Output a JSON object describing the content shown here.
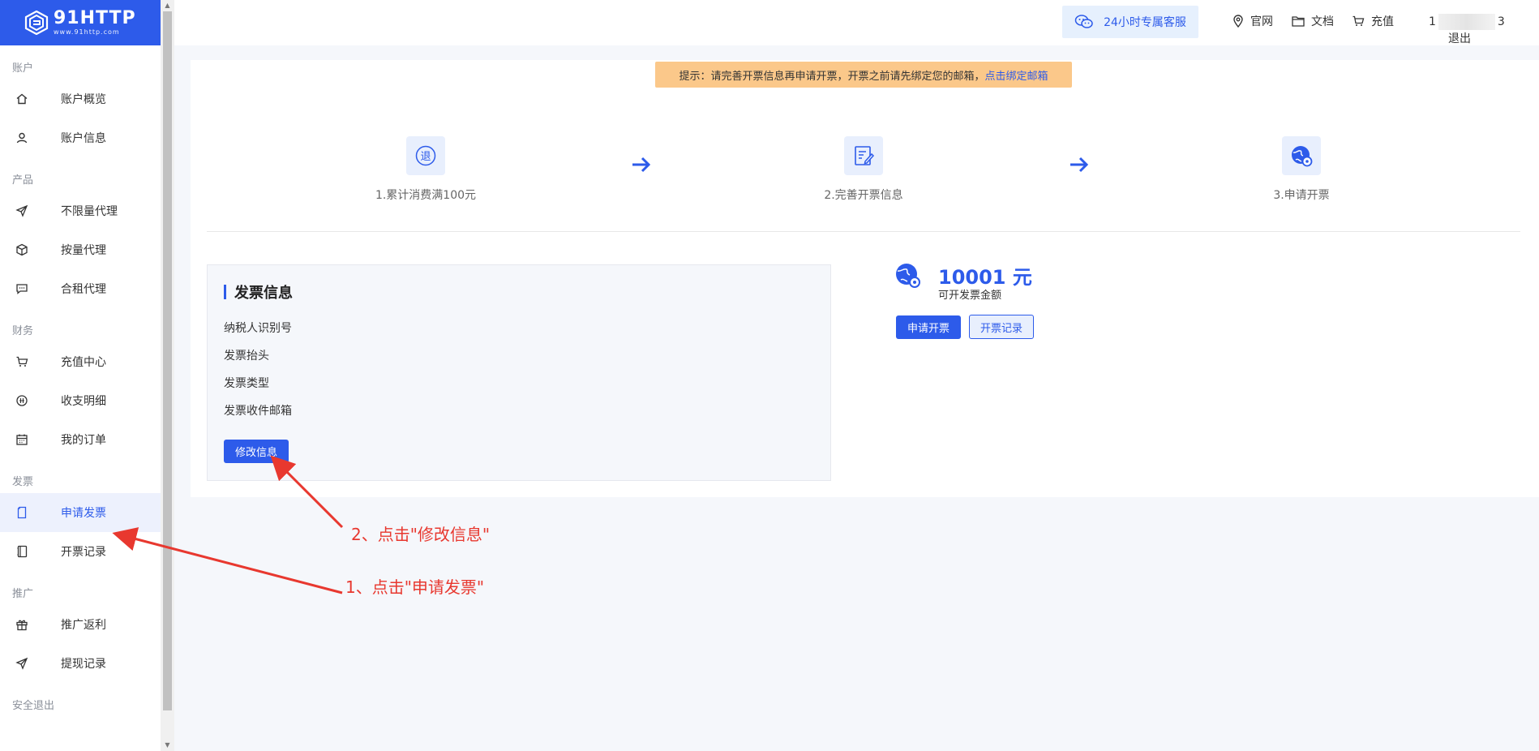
{
  "logo": {
    "name": "91HTTP",
    "url": "www.91http.com"
  },
  "sidebar": {
    "sections": [
      {
        "title": "账户",
        "items": [
          {
            "label": "账户概览",
            "icon": "home-icon"
          },
          {
            "label": "账户信息",
            "icon": "user-icon"
          }
        ]
      },
      {
        "title": "产品",
        "items": [
          {
            "label": "不限量代理",
            "icon": "send-icon"
          },
          {
            "label": "按量代理",
            "icon": "box-icon"
          },
          {
            "label": "合租代理",
            "icon": "chat-icon"
          }
        ]
      },
      {
        "title": "财务",
        "items": [
          {
            "label": "充值中心",
            "icon": "cart-icon"
          },
          {
            "label": "收支明细",
            "icon": "coin-icon"
          },
          {
            "label": "我的订单",
            "icon": "calendar-icon"
          }
        ]
      },
      {
        "title": "发票",
        "items": [
          {
            "label": "申请发票",
            "icon": "document-icon",
            "active": true
          },
          {
            "label": "开票记录",
            "icon": "notebook-icon"
          }
        ]
      },
      {
        "title": "推广",
        "items": [
          {
            "label": "推广返利",
            "icon": "gift-icon"
          },
          {
            "label": "提现记录",
            "icon": "send-icon"
          }
        ]
      },
      {
        "title": "安全退出",
        "items": []
      }
    ]
  },
  "topbar": {
    "support": "24小时专属客服",
    "official": "官网",
    "docs": "文档",
    "recharge": "充值",
    "user_prefix": "1",
    "user_suffix": "3",
    "logout": "退出"
  },
  "notice": {
    "text": "提示：请完善开票信息再申请开票，开票之前请先绑定您的邮箱，",
    "link": "点击绑定邮箱"
  },
  "steps": [
    {
      "label": "1.累计消费满100元",
      "icon_text": "退"
    },
    {
      "label": "2.完善开票信息"
    },
    {
      "label": "3.申请开票"
    }
  ],
  "invoice": {
    "title": "发票信息",
    "fields": [
      "纳税人识别号",
      "发票抬头",
      "发票类型",
      "发票收件邮箱"
    ],
    "edit_button": "修改信息"
  },
  "amount": {
    "value": "10001 元",
    "label": "可开发票金额",
    "apply_button": "申请开票",
    "records_button": "开票记录"
  },
  "annotations": {
    "step1": "1、点击\"申请发票\"",
    "step2": "2、点击\"修改信息\""
  },
  "colors": {
    "brand": "#2d5bea",
    "notice_bg": "#fbc88a",
    "annotation": "#e8382f"
  }
}
